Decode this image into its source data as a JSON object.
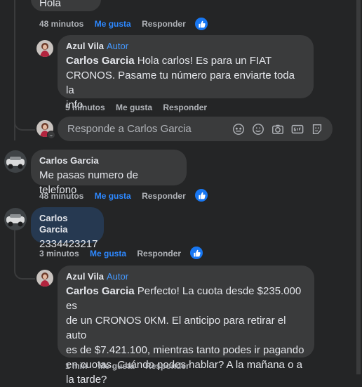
{
  "top_comment": {
    "text_tail": "Hola",
    "time": "48 minutos",
    "like_label": "Me gusta",
    "reply_label": "Responder"
  },
  "reply1": {
    "author": "Azul Vila",
    "badge": "Autor",
    "mention": "Carlos Garcia",
    "line1": " Hola carlos! Es para un FIAT",
    "line2": "CRONOS. Pasame tu número para enviarte toda la",
    "line3": "info",
    "time": "5 minutos",
    "like_label": "Me gusta",
    "reply_label": "Responder"
  },
  "reply_box": {
    "placeholder": "Responde a Carlos Garcia"
  },
  "comment2": {
    "author": "Carlos Garcia",
    "text": "Me pasas numero de telefono",
    "time": "48 minutos",
    "like_label": "Me gusta",
    "reply_label": "Responder"
  },
  "comment3": {
    "author": "Carlos Garcia",
    "text": "2334423217",
    "time": "3 minutos",
    "like_label": "Me gusta",
    "reply_label": "Responder"
  },
  "reply2": {
    "author": "Azul Vila",
    "badge": "Autor",
    "mention": "Carlos Garcia",
    "line1": " Perfecto! La cuota desde $235.000 es",
    "line2": "de un CRONOS 0KM. El anticipo para retirar el auto",
    "line3": "es de $7.421.100, mientras tanto podes ir pagando",
    "line4": "en cuotas. Cuándo podes hablar? A la mañana o a",
    "line5": "la tarde?",
    "time": "1 min",
    "like_label": "Me gusta",
    "reply_label": "Responder"
  },
  "colors": {
    "background": "#242526",
    "bubble": "#3a3b3c",
    "highlight_bubble": "#263951",
    "accent": "#2d88ff",
    "muted": "#b0b3b8"
  }
}
